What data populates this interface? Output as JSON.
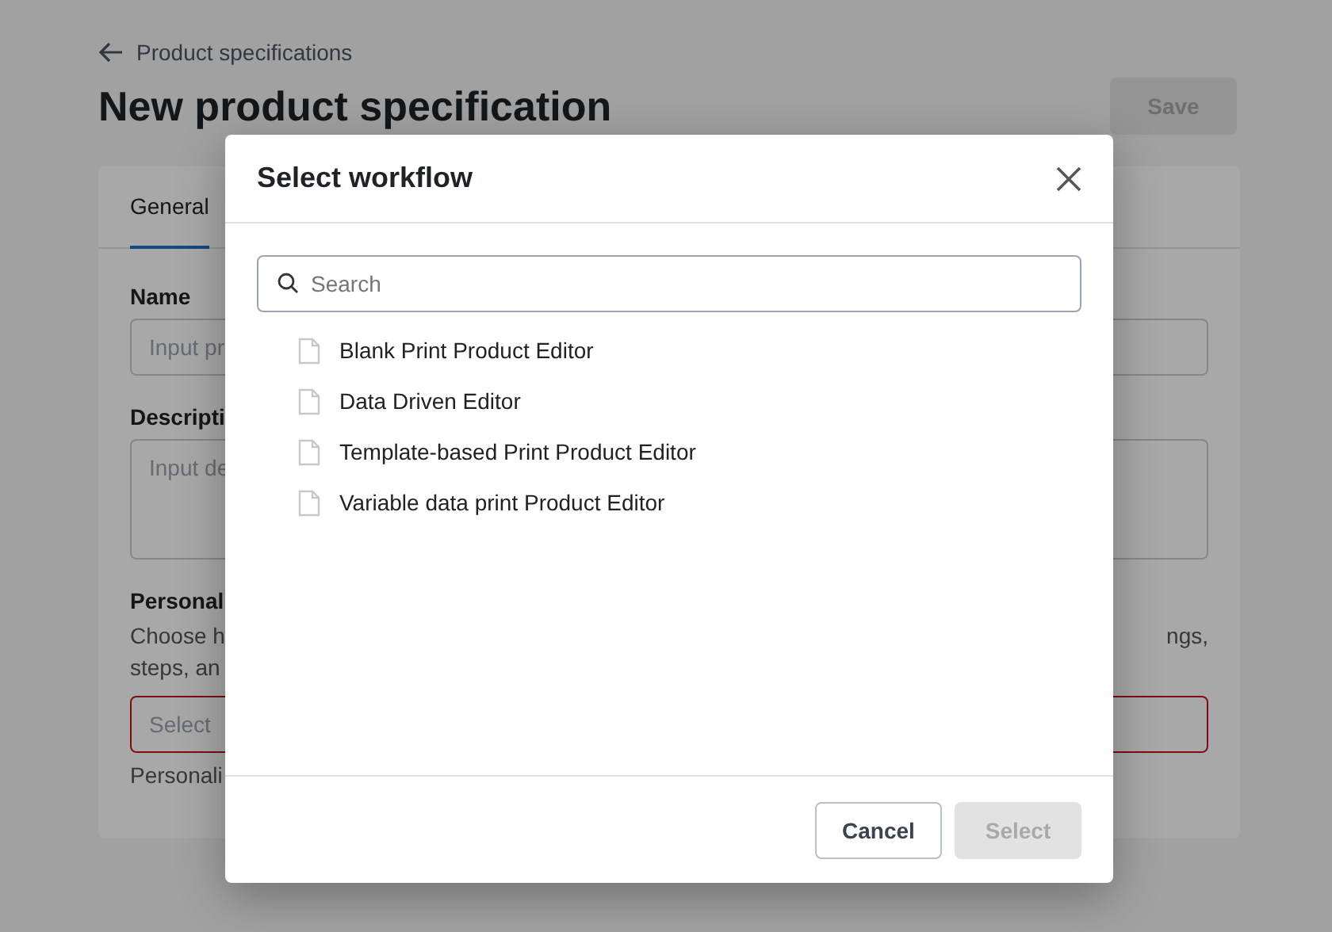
{
  "page": {
    "back_link": "Product specifications",
    "title": "New product specification",
    "save_button": {
      "label": "Save",
      "disabled": true
    }
  },
  "tabs": [
    {
      "label": "General",
      "selected": true
    }
  ],
  "form": {
    "name_label": "Name",
    "name_placeholder": "Input pr",
    "description_label": "Descripti",
    "description_placeholder": "Input de",
    "personalization_label": "Personal",
    "personalization_text_line_1_start": "Choose h",
    "personalization_text_line_1_end": "ngs,",
    "personalization_text_line_2": "steps, an",
    "workflow_placeholder": "Select",
    "workflow_invalid": true,
    "helper_text": "Personali"
  },
  "dialog": {
    "title": "Select workflow",
    "search": {
      "placeholder": "Search"
    },
    "items": [
      {
        "label": "Blank Print Product Editor"
      },
      {
        "label": "Data Driven Editor"
      },
      {
        "label": "Template-based Print Product Editor"
      },
      {
        "label": "Variable data print Product Editor"
      }
    ],
    "buttons": [
      {
        "label": "Cancel",
        "kind": "secondary",
        "disabled": false
      },
      {
        "label": "Select",
        "kind": "primary",
        "disabled": true
      }
    ]
  }
}
